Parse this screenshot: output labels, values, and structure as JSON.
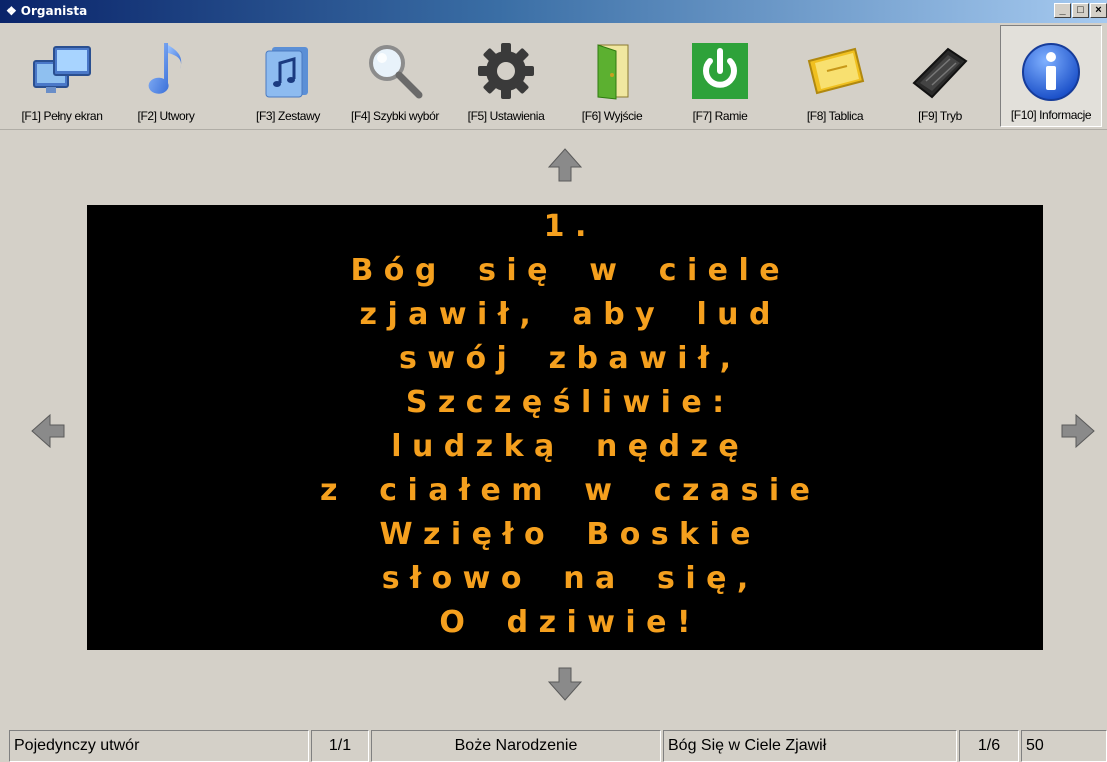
{
  "window": {
    "title": "Organista",
    "controls": [
      "_",
      "□",
      "×"
    ]
  },
  "toolbar": {
    "items": [
      {
        "label": "[F1] Pełny ekran",
        "icon": "monitors-icon"
      },
      {
        "label": "[F2] Utwory",
        "icon": "music-note-icon"
      },
      {
        "label": "[F3] Zestawy",
        "icon": "music-folder-icon"
      },
      {
        "label": "[F4] Szybki wybór",
        "icon": "magnifier-icon"
      },
      {
        "label": "[F5] Ustawienia",
        "icon": "gear-icon"
      },
      {
        "label": "[F6] Wyjście",
        "icon": "door-icon"
      },
      {
        "label": "[F7] Ramie",
        "icon": "power-icon"
      },
      {
        "label": "[F8] Tablica",
        "icon": "board-icon"
      },
      {
        "label": "[F9] Tryb",
        "icon": "keyboard-icon"
      },
      {
        "label": "[F10] Informacje",
        "icon": "info-icon"
      }
    ]
  },
  "lyrics": {
    "verse_number": "1 .",
    "lines": [
      "B ó g    s i ę    w    c i e l e",
      "z j a w i ł ,    a b y    l u d",
      "s w ó j    z b a w i ł ,",
      "S z c z ę ś l i w i e :",
      "l u d z k ą    n ę d z ę",
      "z    c i a ł e m    w    c z a s i e",
      "W z i ę ł o    B o s k i e",
      "s ł o w o    n a    s i ę ,",
      "O    d z i w i e !"
    ],
    "text_color": "#f5a01e",
    "background": "#000000"
  },
  "navigation": {
    "up": "arrow-up-icon",
    "down": "arrow-down-icon",
    "left": "arrow-left-icon",
    "right": "arrow-right-icon"
  },
  "status": {
    "mode": "Pojedynczy utwór",
    "set_position": "1/1",
    "set_name": "Boże Narodzenie",
    "song_title": "Bóg Się w Ciele Zjawił",
    "verse_position": "1/6",
    "number": "50"
  }
}
